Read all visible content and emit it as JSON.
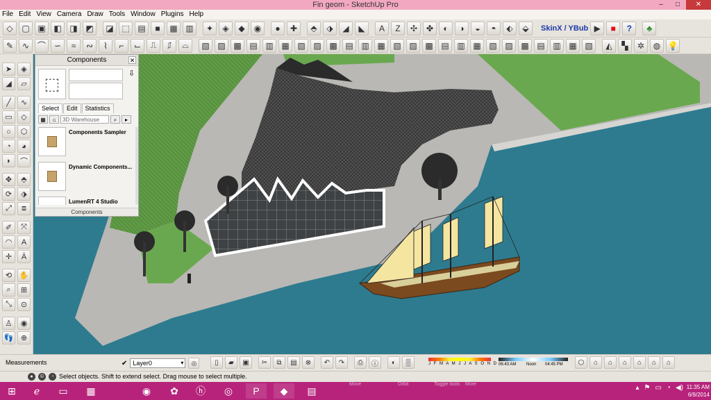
{
  "window": {
    "title": "Fin geom - SketchUp Pro",
    "minimize_glyph": "–",
    "maximize_glyph": "□",
    "close_glyph": "✕"
  },
  "menu": [
    "File",
    "Edit",
    "View",
    "Camera",
    "Draw",
    "Tools",
    "Window",
    "Plugins",
    "Help"
  ],
  "toolbar": {
    "skin_label": "SkinX / YBub"
  },
  "components_panel": {
    "title": "Components",
    "tabs": [
      "Select",
      "Edit",
      "Statistics"
    ],
    "search_placeholder": "3D Warehouse",
    "items": [
      {
        "name": "Components Sampler"
      },
      {
        "name": "Dynamic Components..."
      },
      {
        "name": "LumenRT 4 Studio"
      }
    ],
    "footer": "Components"
  },
  "bottom_bar": {
    "measurements_label": "Measurements",
    "layer": "Layer0",
    "months": "J F M A M J J A S O N D",
    "time_start": "06:43 AM",
    "time_mid": "Noon",
    "time_end": "04:45 PM"
  },
  "status": {
    "text": "Select objects. Shift to extend select. Drag mouse to select multiple."
  },
  "taskbar": {
    "ghost_labels": [
      "Move",
      "Orbit",
      "Toggle tools",
      "More"
    ],
    "time": "11:35 AM",
    "date": "6/9/2014"
  },
  "colors": {
    "water": "#2e7b8f",
    "pavement": "#b8b7b3",
    "grass": "#6aa84f",
    "accent_titlebar": "#f2a8c0",
    "taskbar": "#b7237b"
  }
}
